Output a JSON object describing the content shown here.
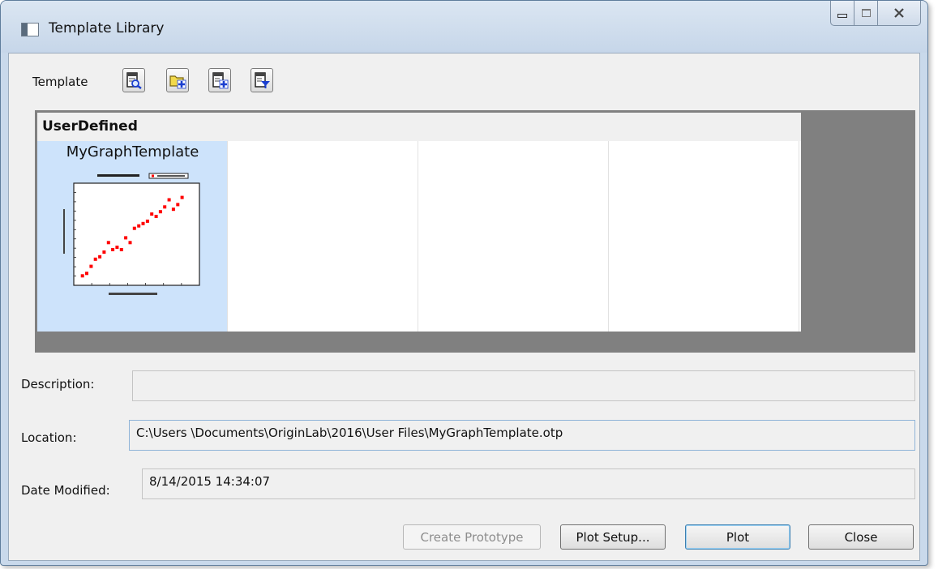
{
  "window": {
    "title": "Template Library"
  },
  "toolbar": {
    "label": "Template",
    "buttons": [
      {
        "icon": "template-view-icon"
      },
      {
        "icon": "add-folder-icon"
      },
      {
        "icon": "add-template-icon"
      },
      {
        "icon": "filter-template-icon"
      }
    ]
  },
  "gallery": {
    "group": "UserDefined",
    "items": [
      {
        "name": "MyGraphTemplate",
        "selected": true
      }
    ]
  },
  "description": {
    "label": "Description:",
    "value": ""
  },
  "location": {
    "label": "Location:",
    "value": "C:\\Users \\Documents\\OriginLab\\2016\\User Files\\MyGraphTemplate.otp"
  },
  "date_modified": {
    "label": "Date Modified:",
    "value": "8/14/2015 14:34:07"
  },
  "buttons": {
    "create_prototype": "Create Prototype",
    "plot_setup": "Plot Setup...",
    "plot": "Plot",
    "close": "Close"
  },
  "colors": {
    "title_bar": "#c9d9eb",
    "gallery_bg": "#808080",
    "selected_cell": "#cde3fb",
    "plot_points": "#ff0000"
  },
  "chart_data": {
    "type": "scatter",
    "series": [
      {
        "x": [
          2,
          3,
          4,
          5,
          6,
          7,
          8,
          9,
          10,
          11,
          12,
          13,
          14,
          15,
          16,
          17,
          18,
          19,
          20,
          21,
          22,
          23,
          24,
          25
        ],
        "y": [
          2,
          3,
          6,
          9,
          10,
          12,
          16,
          13,
          14,
          13,
          18,
          16,
          22,
          23,
          24,
          25,
          28,
          27,
          29,
          31,
          34,
          30,
          32,
          35
        ]
      }
    ]
  }
}
